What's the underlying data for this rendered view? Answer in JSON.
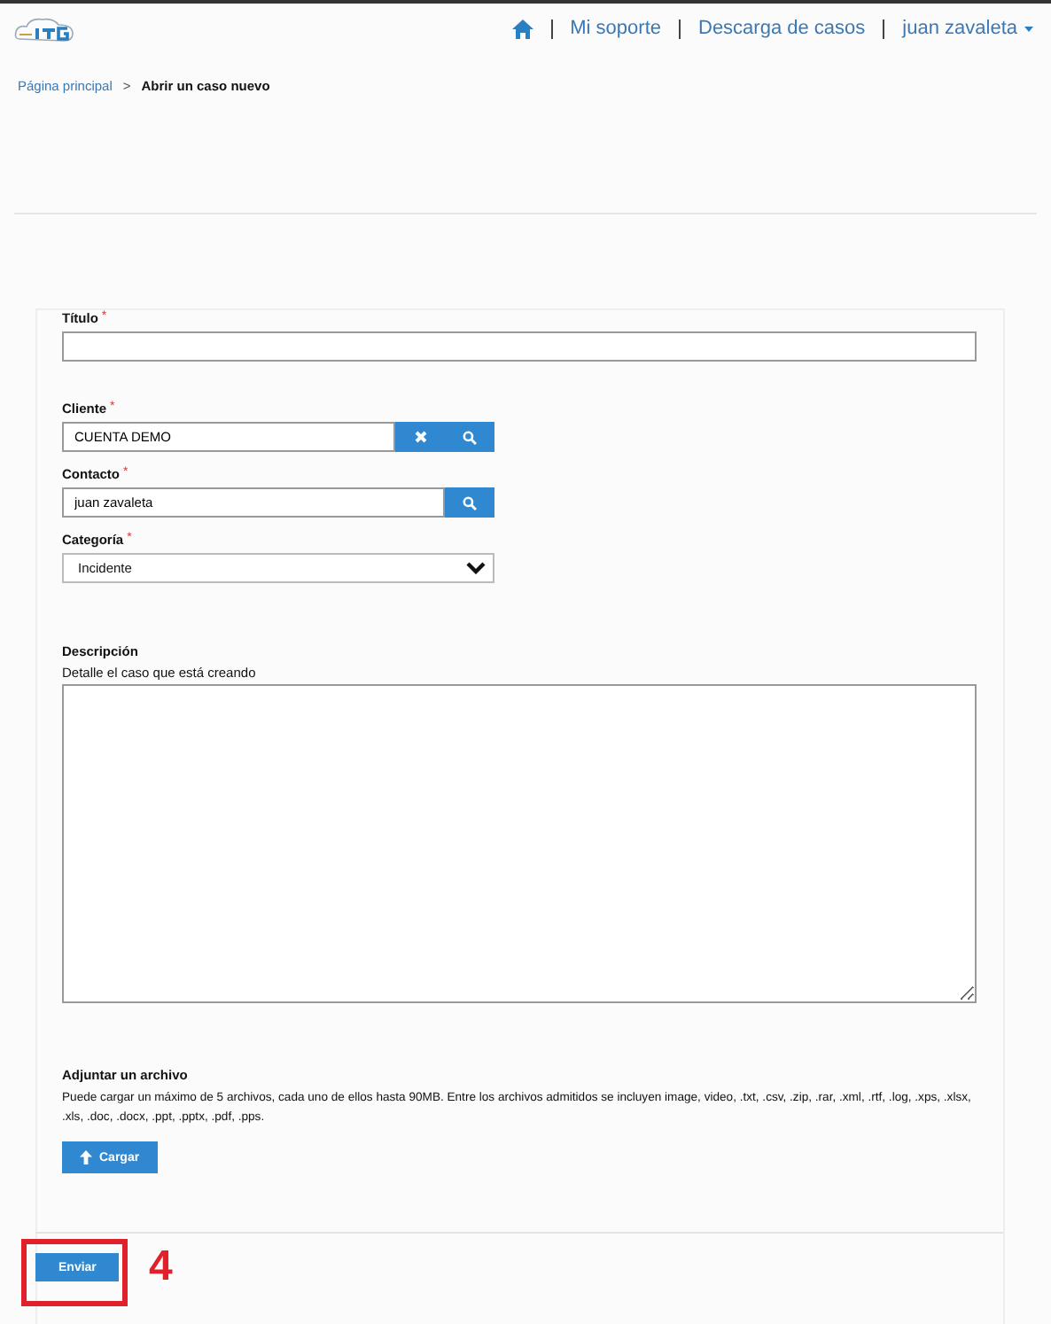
{
  "nav": {
    "items": [
      "Mi soporte",
      "Descarga de casos",
      "juan zavaleta"
    ]
  },
  "breadcrumb": {
    "parent": "Página principal",
    "separator": ">",
    "current": "Abrir un caso nuevo"
  },
  "form": {
    "fields": [
      {
        "kind": "text",
        "label": "Título",
        "required_mark": "*"
      },
      {
        "kind": "lookup",
        "label": "Cliente",
        "required_mark": "*",
        "value": "CUENTA DEMO",
        "clearable": true
      },
      {
        "kind": "lookup",
        "label": "Contacto",
        "required_mark": "*",
        "value": "juan zavaleta",
        "clearable": false
      },
      {
        "kind": "select",
        "label": "Categoría",
        "required_mark": "*",
        "value": "Incidente"
      },
      {
        "kind": "textarea",
        "label": "Descripción",
        "hint": "Detalle el caso que está creando"
      }
    ],
    "attachment": {
      "title": "Adjuntar un archivo",
      "text": "Puede cargar un máximo de 5 archivos, cada uno de ellos hasta 90MB. Entre los archivos admitidos se incluyen image, video, .txt, .csv, .zip, .rar, .xml, .rtf, .log, .xps, .xlsx, .xls, .doc, .docx, .ppt, .pptx, .pdf, .pps.",
      "button": "Cargar"
    },
    "submit": "Enviar"
  },
  "annotation": {
    "label": "4"
  }
}
